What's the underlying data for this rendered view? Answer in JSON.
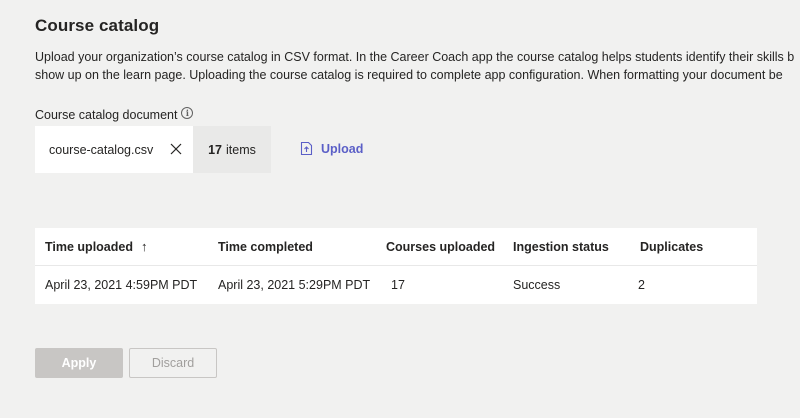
{
  "page": {
    "title": "Course catalog",
    "description_line1": "Upload your organization’s course catalog in CSV format. In the Career Coach app the course catalog helps students identify their skills b",
    "description_line2": "show up on the learn page. Uploading the course catalog is required to complete app configuration. When formatting your document be"
  },
  "upload": {
    "field_label": "Course catalog document",
    "info_icon": "info-icon",
    "file_name": "course-catalog.csv",
    "item_count": "17",
    "item_suffix": "items",
    "upload_label": "Upload"
  },
  "table": {
    "headers": [
      "Time uploaded",
      "Time completed",
      "Courses uploaded",
      "Ingestion status",
      "Duplicates"
    ],
    "sort_indicator": "↑",
    "rows": [
      [
        "April 23, 2021 4:59PM PDT",
        "April 23, 2021 5:29PM PDT",
        "17",
        "Success",
        "2"
      ]
    ]
  },
  "actions": {
    "apply_label": "Apply",
    "discard_label": "Discard"
  },
  "colors": {
    "background": "#f1f1f0",
    "accent": "#5b5fc7",
    "disabled_button": "#c8c6c4"
  }
}
